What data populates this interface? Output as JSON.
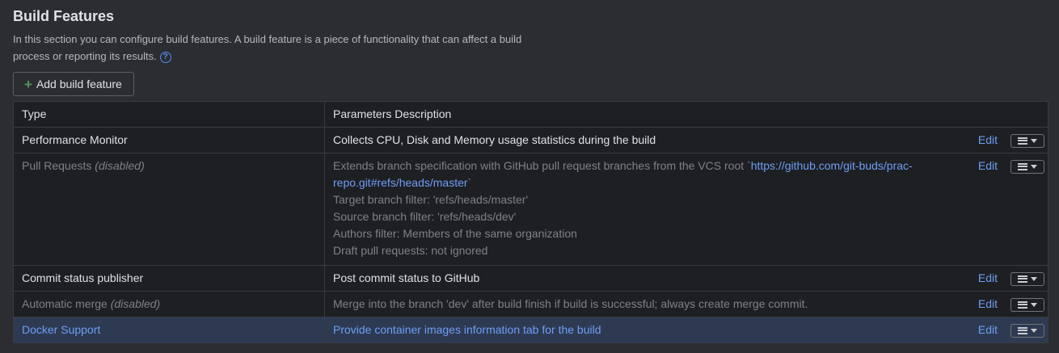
{
  "section": {
    "title": "Build Features",
    "description": "In this section you can configure build features. A build feature is a piece of functionality that can affect a build process or reporting its results.",
    "help_icon": "question-circle-icon",
    "add_button_label": "Add build feature",
    "add_button_icon": "plus-icon"
  },
  "table": {
    "headers": [
      "Type",
      "Parameters Description"
    ],
    "rows": [
      {
        "type": "Performance Monitor",
        "disabled_tag": "",
        "params": [
          "Collects CPU, Disk and Memory usage statistics during the build"
        ],
        "edit": "Edit"
      },
      {
        "type": "Pull Requests",
        "disabled_tag": "(disabled)",
        "params_prefix": "Extends branch specification with GitHub pull request branches from the VCS root `",
        "params_link": "https://github.com/git-buds/prac-repo.git#refs/heads/master",
        "params_suffix": "`",
        "params": [
          "Target branch filter: 'refs/heads/master'",
          "Source branch filter: 'refs/heads/dev'",
          "Authors filter: Members of the same organization",
          "Draft pull requests: not ignored"
        ],
        "edit": "Edit"
      },
      {
        "type": "Commit status publisher",
        "disabled_tag": "",
        "params": [
          "Post commit status to GitHub"
        ],
        "edit": "Edit"
      },
      {
        "type": "Automatic merge",
        "disabled_tag": "(disabled)",
        "params": [
          "Merge into the branch 'dev' after build finish if build is successful; always create merge commit."
        ],
        "edit": "Edit"
      },
      {
        "type": "Docker Support",
        "disabled_tag": "",
        "params": [
          "Provide container images information tab for the build"
        ],
        "edit": "Edit"
      }
    ]
  },
  "colors": {
    "background": "#2b2d30",
    "table_bg": "#1e1f22",
    "link": "#6e9ef5",
    "selected_row": "#2e3a52"
  }
}
